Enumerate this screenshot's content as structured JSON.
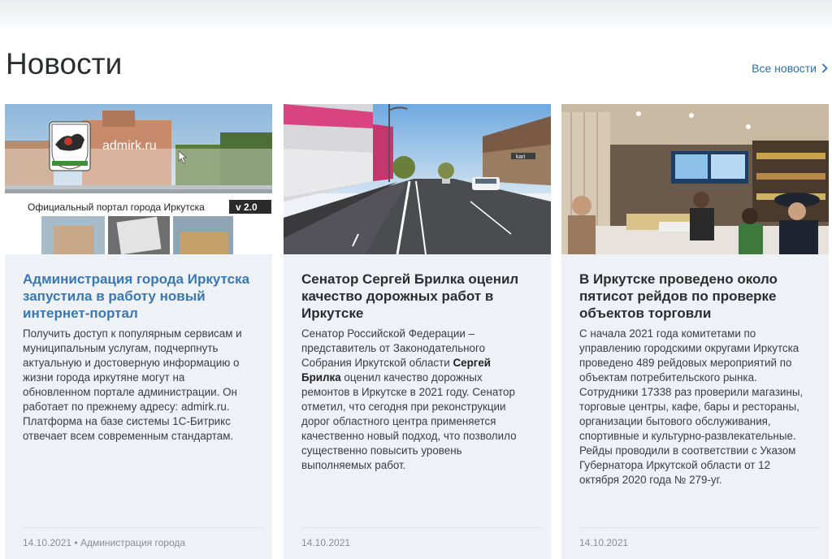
{
  "section": {
    "title": "Новости",
    "all_news_label": "Все новости"
  },
  "cards": [
    {
      "title": "Администрация города Иркутска запустила в работу новый интернет-портал",
      "text": "Получить доступ к популярным сервисам и муниципальным услугам, подчерпнуть актуальную и достоверную информацию о жизни города иркутяне могут на обновленном портале администрации. Он работает по прежнему адресу: admirk.ru. Платформа на базе системы 1С-Битрикс отвечает всем современным стандартам.",
      "date": "14.10.2021",
      "source": "Администрация города",
      "image": {
        "site_label": "admirk.ru",
        "caption": "Официальный портал города Иркутска",
        "version": "v 2.0"
      }
    },
    {
      "title": "Сенатор Сергей Брилка оценил качество дорожных работ в Иркутске",
      "text_before": "Сенатор Российской Федерации – представитель от Законодательного Собрания Иркутской области ",
      "text_bold": "Сергей Брилка",
      "text_after": " оценил качество дорожных ремонтов в Иркутске в 2021 году. Сенатор отметил, что сегодня при реконструкции дорог областного центра применяется качественно новый подход, что позволило существенно повысить уровень выполняемых работ.",
      "date": "14.10.2021",
      "image": {
        "storefront_sign": "kari"
      }
    },
    {
      "title": "В Иркутске проведено около пятисот рейдов по проверке объектов торговли",
      "text": "С начала 2021 года комитетами по управлению городскими округами Иркутска проведено 489 рейдовых мероприятий по объектам потребительского рынка. Сотрудники 17338 раз проверили магазины, торговые центры, кафе, бары и рестораны, организации бытового обслуживания, спортивные и культурно-развлекательные. Рейды проводили в соответствии с Указом Губернатора Иркутской области от 12 октября 2020 года № 279-уг.",
      "date": "14.10.2021"
    }
  ],
  "footer_separator": " • ",
  "colors": {
    "accent": "#3a78b0",
    "card_bg": "#eef1f5",
    "link": "#2f6ea6"
  }
}
